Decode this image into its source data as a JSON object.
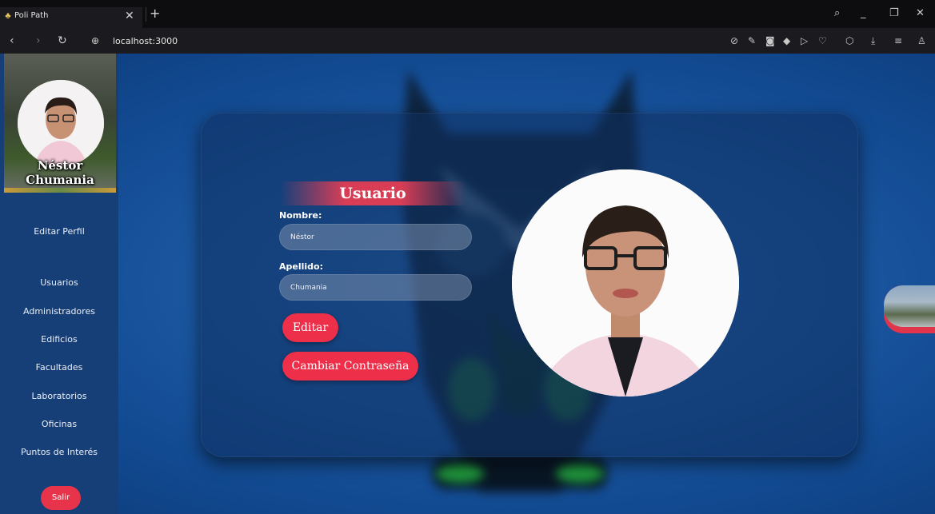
{
  "browser": {
    "tab_title": "Poli Path",
    "tab_close": "✕",
    "new_tab": "+",
    "url": "localhost:3000",
    "icons": [
      "zoom-icon",
      "edit-icon",
      "screenshot-icon",
      "shield-icon",
      "send-icon",
      "heart-icon",
      "cube-icon",
      "download-icon",
      "menu-icon",
      "profile-icon"
    ]
  },
  "sidebar": {
    "profile_name": "Néstor Chumania",
    "items": [
      {
        "label": "Editar Perfil"
      },
      {
        "label": "Usuarios"
      },
      {
        "label": "Administradores"
      },
      {
        "label": "Edificios"
      },
      {
        "label": "Facultades"
      },
      {
        "label": "Laboratorios"
      },
      {
        "label": "Oficinas"
      },
      {
        "label": "Puntos de Interés"
      }
    ],
    "logout_label": "Salir"
  },
  "card": {
    "title": "Usuario",
    "nombre_label": "Nombre:",
    "nombre_value": "Néstor",
    "apellido_label": "Apellido:",
    "apellido_value": "Chumania",
    "edit_button": "Editar",
    "change_password_button": "Cambiar Contraseña"
  },
  "colors": {
    "accent": "#ed2f4a",
    "sidebar": "#173f77",
    "background": "#1d5aa4"
  }
}
